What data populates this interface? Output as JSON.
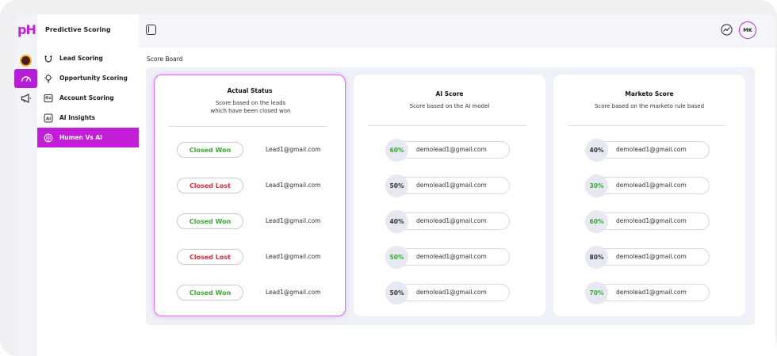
{
  "app": {
    "logo": "pH",
    "title": "Predictive Scoring"
  },
  "user": {
    "initials": "MK"
  },
  "menu": [
    {
      "label": "Lead Scoring",
      "icon": "magnet-icon",
      "active": false
    },
    {
      "label": "Opportunity Scoring",
      "icon": "bulb-icon",
      "active": false
    },
    {
      "label": "Account Scoring",
      "icon": "account-card-icon",
      "active": false
    },
    {
      "label": "AI Insights",
      "icon": "ai-chip-icon",
      "active": false
    },
    {
      "label": "Humen Vs AI",
      "icon": "brain-icon",
      "active": true
    }
  ],
  "scoreboard": {
    "title": "Score Board",
    "actual": {
      "title": "Actual Status",
      "subtitle_line1": "Score based on the leads",
      "subtitle_line2": "which have been closed won",
      "rows": [
        {
          "status": "Closed Won",
          "email": "Lead1@gmail.com"
        },
        {
          "status": "Closed Lost",
          "email": "Lead1@gmail.com"
        },
        {
          "status": "Closed Won",
          "email": "Lead1@gmail.com"
        },
        {
          "status": "Closed Lost",
          "email": "Lead1@gmail.com"
        },
        {
          "status": "Closed Won",
          "email": "Lead1@gmail.com"
        }
      ]
    },
    "ai": {
      "title": "AI Score",
      "subtitle": "Score based on the AI model",
      "rows": [
        {
          "score": "60%",
          "email": "demolead1@gmail.com"
        },
        {
          "score": "50%",
          "email": "demolead1@gmail.com"
        },
        {
          "score": "40%",
          "email": "demolead1@gmail.com"
        },
        {
          "score": "50%",
          "email": "demolead1@gmail.com"
        },
        {
          "score": "50%",
          "email": "demolead1@gmail.com"
        }
      ]
    },
    "marketo": {
      "title": "Marketo Score",
      "subtitle": "Score based on the marketo rule based",
      "rows": [
        {
          "score": "40%",
          "email": "demolead1@gmail.com"
        },
        {
          "score": "30%",
          "email": "demolead1@gmail.com"
        },
        {
          "score": "60%",
          "email": "demolead1@gmail.com"
        },
        {
          "score": "80%",
          "email": "demolead1@gmail.com"
        },
        {
          "score": "70%",
          "email": "demolead1@gmail.com"
        }
      ]
    }
  },
  "colors": {
    "accent": "#c21ed8",
    "won": "#3fa535",
    "lost": "#e02b3a"
  }
}
